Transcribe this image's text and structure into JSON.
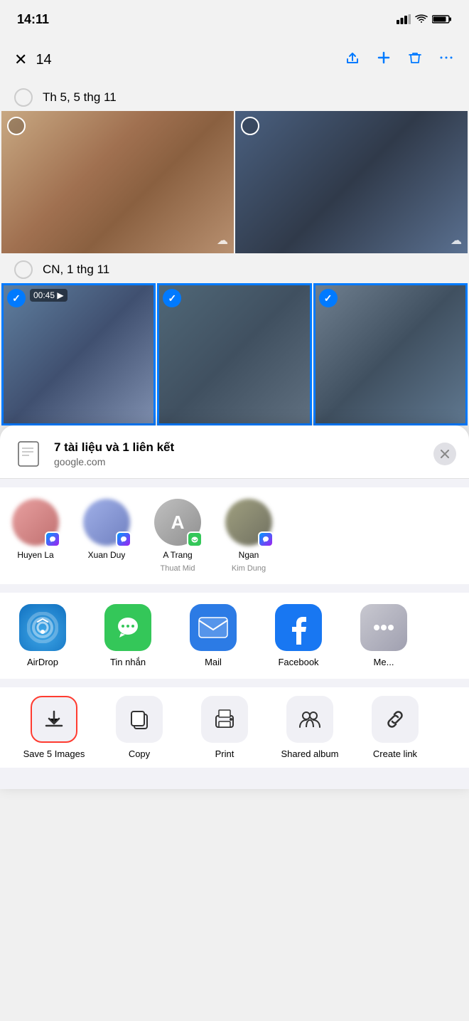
{
  "statusBar": {
    "time": "14:11",
    "signal": "▎▎▎",
    "wifi": "wifi",
    "battery": "battery"
  },
  "toolbar": {
    "count": "14",
    "closeLabel": "✕",
    "shareLabel": "⬆",
    "addLabel": "+",
    "deleteLabel": "🗑",
    "moreLabel": "..."
  },
  "dates": {
    "date1": "Th 5, 5 thg 11",
    "date2": "CN, 1 thg 11"
  },
  "shareSheet": {
    "title": "7 tài liệu và 1 liên kết",
    "subtitle": "google.com",
    "closeLabel": "✕"
  },
  "contacts": [
    {
      "name": "Huyen La",
      "sub": "",
      "avatarClass": "avatar-1",
      "badge": "messenger"
    },
    {
      "name": "Xuan Duy",
      "sub": "",
      "avatarClass": "avatar-2",
      "badge": "messenger"
    },
    {
      "name": "A Trang",
      "sub": "Thuat Mid",
      "avatarClass": "avatar-3",
      "badge": "messages"
    },
    {
      "name": "Ngan",
      "sub": "Kim Dung",
      "avatarClass": "avatar-4",
      "badge": "messenger"
    }
  ],
  "apps": [
    {
      "name": "AirDrop",
      "iconClass": "airdrop",
      "symbol": "airdrop"
    },
    {
      "name": "Tin nhắn",
      "iconClass": "messages",
      "symbol": "💬"
    },
    {
      "name": "Mail",
      "iconClass": "mail",
      "symbol": "✉"
    },
    {
      "name": "Facebook",
      "iconClass": "facebook",
      "symbol": "f"
    },
    {
      "name": "Me...",
      "iconClass": "more",
      "symbol": "..."
    }
  ],
  "actions": [
    {
      "name": "Save 5 Images",
      "symbol": "⬇",
      "selected": true
    },
    {
      "name": "Copy",
      "symbol": "⧉",
      "selected": false
    },
    {
      "name": "Print",
      "symbol": "🖨",
      "selected": false
    },
    {
      "name": "Shared album",
      "symbol": "👥",
      "selected": false
    },
    {
      "name": "Create link",
      "symbol": "🔗",
      "selected": false
    }
  ]
}
